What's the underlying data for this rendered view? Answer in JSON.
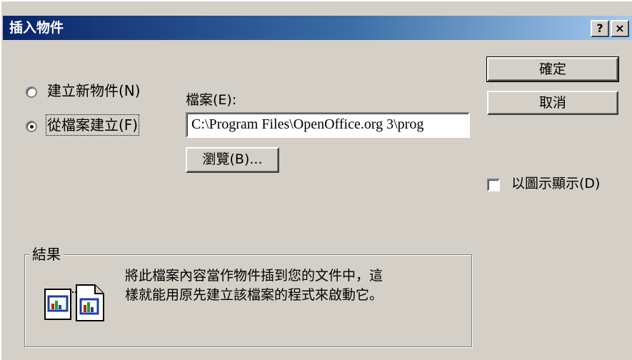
{
  "dialog": {
    "title": "插入物件",
    "help_button": "?",
    "close_button": "×"
  },
  "options": {
    "create_new": "建立新物件(N)",
    "create_from_file": "從檔案建立(F)",
    "selected": "create_from_file"
  },
  "file": {
    "label": "檔案(E):",
    "path": "C:\\Program Files\\OpenOffice.org 3\\prog",
    "browse_label": "瀏覽(B)..."
  },
  "buttons": {
    "ok": "確定",
    "cancel": "取消"
  },
  "display_as_icon": {
    "label": "以圖示顯示(D)",
    "checked": false
  },
  "result": {
    "legend": "結果",
    "line1": "將此檔案內容當作物件插到您的文件中，這",
    "line2": "樣就能用原先建立該檔案的程式來啟動它。"
  },
  "colors": {
    "title_bar_start": "#0a246a",
    "title_bar_end": "#a6caf0",
    "face": "#d4d0c8"
  }
}
